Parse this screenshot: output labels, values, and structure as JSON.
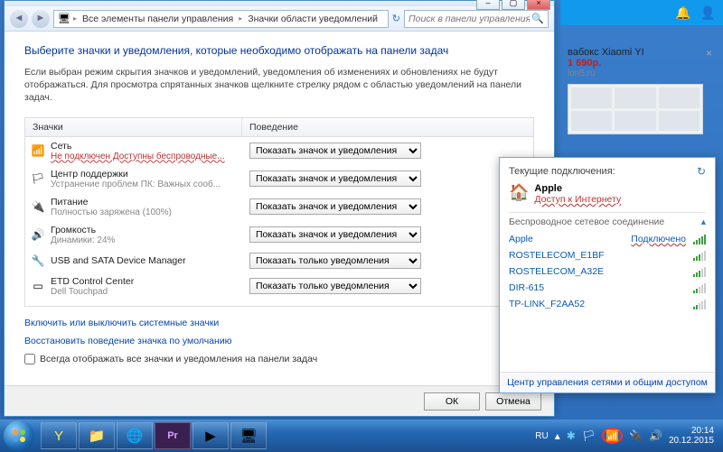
{
  "browser": {
    "bell_icon": "🔔",
    "user_icon": "👤"
  },
  "ad": {
    "title_part": "вабокс Xiaomi YI",
    "price": "1 690р.",
    "site": "ion5.ru"
  },
  "window": {
    "breadcrumb": {
      "root_icon": "🖥",
      "part1": "Все элементы панели управления",
      "part2": "Значки области уведомлений"
    },
    "search_placeholder": "Поиск в панели управления",
    "title": "Выберите значки и уведомления, которые необходимо отображать на панели задач",
    "desc": "Если выбран режим скрытия значков и уведомлений, уведомления об изменениях и обновлениях не будут отображаться. Для просмотра спрятанных значков щелкните стрелку рядом с областью уведомлений на панели задач.",
    "col_icons": "Значки",
    "col_behavior": "Поведение",
    "items": [
      {
        "icon": "📶",
        "name": "Сеть",
        "sub": "Не подключен Доступны беспроводные...",
        "sub_red": true,
        "sel": "Показать значок и уведомления"
      },
      {
        "icon": "🏳",
        "name": "Центр поддержки",
        "sub": "Устранение проблем ПК: Важных сооб...",
        "sel": "Показать значок и уведомления"
      },
      {
        "icon": "🔌",
        "name": "Питание",
        "sub": "Полностью заряжена (100%)",
        "sel": "Показать значок и уведомления"
      },
      {
        "icon": "🔊",
        "name": "Громкость",
        "sub": "Динамики: 24%",
        "sel": "Показать значок и уведомления"
      },
      {
        "icon": "🔧",
        "name": "USB and SATA Device Manager",
        "sub": "",
        "sel": "Показать только уведомления"
      },
      {
        "icon": "▭",
        "name": "ETD Control Center",
        "sub": "Dell Touchpad",
        "sel": "Показать только уведомления"
      }
    ],
    "link1": "Включить или выключить системные значки",
    "link2": "Восстановить поведение значка по умолчанию",
    "checkbox": "Всегда отображать все значки и уведомления на панели задач",
    "ok": "ОК",
    "cancel": "Отмена"
  },
  "netflyout": {
    "header": "Текущие подключения:",
    "current_name": "Apple",
    "current_status": "Доступ к Интернету",
    "section": "Беспроводное сетевое соединение",
    "networks": [
      {
        "ssid": "Apple",
        "status": "Подключено",
        "strength": "full"
      },
      {
        "ssid": "ROSTELECOM_E1BF",
        "status": "",
        "strength": "med"
      },
      {
        "ssid": "ROSTELECOM_A32E",
        "status": "",
        "strength": "med"
      },
      {
        "ssid": "DIR-615",
        "status": "",
        "strength": "weak"
      },
      {
        "ssid": "TP-LINK_F2AA52",
        "status": "",
        "strength": "weak"
      }
    ],
    "footer": "Центр управления сетями и общим доступом"
  },
  "taskbar": {
    "lang": "RU",
    "time": "20:14",
    "date": "20.12.2015"
  }
}
